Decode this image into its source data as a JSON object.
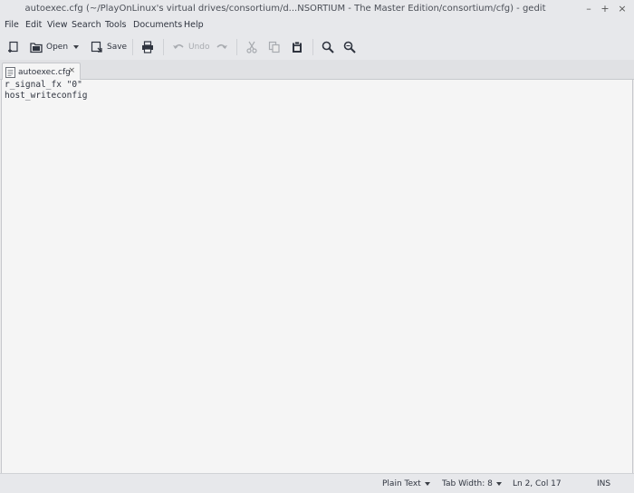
{
  "window": {
    "title": "autoexec.cfg (~/PlayOnLinux's virtual drives/consortium/d...NSORTIUM - The Master Edition/consortium/cfg) - gedit",
    "minimize": "–",
    "maximize": "+",
    "close": "×"
  },
  "menu": {
    "file": "File",
    "edit": "Edit",
    "view": "View",
    "search": "Search",
    "tools": "Tools",
    "documents": "Documents",
    "help": "Help"
  },
  "toolbar": {
    "new_icon": "new-document-icon",
    "open_label": "Open",
    "save_label": "Save",
    "print_icon": "printer-icon",
    "undo_label": "Undo",
    "redo_icon": "redo-icon",
    "cut_icon": "scissors-icon",
    "copy_icon": "copy-icon",
    "paste_icon": "clipboard-icon",
    "find_icon": "search-icon",
    "replace_icon": "find-replace-icon"
  },
  "tab": {
    "label": "autoexec.cfg",
    "close": "×"
  },
  "editor": {
    "lines": [
      "r_signal_fx \"0\"",
      "host_writeconfig"
    ]
  },
  "status": {
    "language": "Plain Text",
    "tab_width": "Tab Width:  8",
    "position": "Ln 2, Col 17",
    "mode": "INS"
  },
  "colors": {
    "background": "#ebebeb",
    "editor_bg": "#f5f5f5",
    "text": "#2f343f",
    "disabled": "#a8abb0"
  }
}
